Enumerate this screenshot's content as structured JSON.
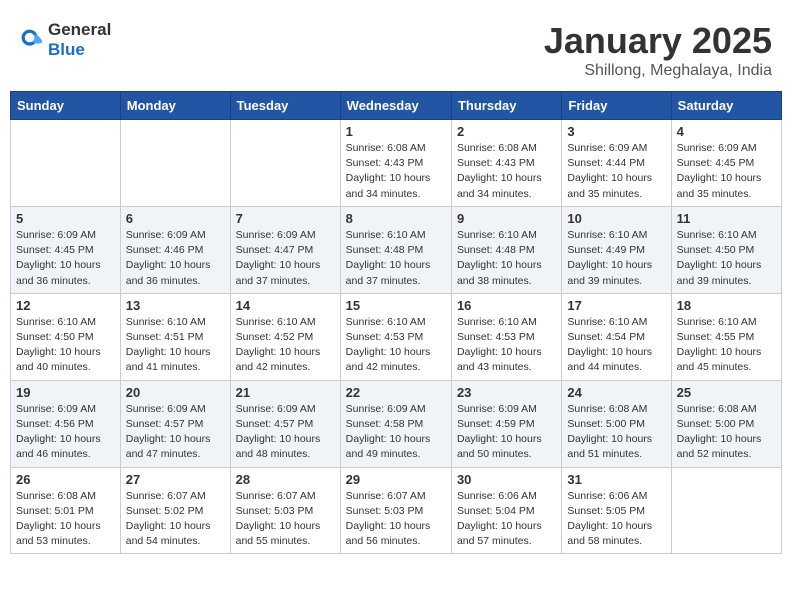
{
  "header": {
    "logo_general": "General",
    "logo_blue": "Blue",
    "title": "January 2025",
    "subtitle": "Shillong, Meghalaya, India"
  },
  "weekdays": [
    "Sunday",
    "Monday",
    "Tuesday",
    "Wednesday",
    "Thursday",
    "Friday",
    "Saturday"
  ],
  "weeks": [
    [
      {
        "day": "",
        "info": ""
      },
      {
        "day": "",
        "info": ""
      },
      {
        "day": "",
        "info": ""
      },
      {
        "day": "1",
        "info": "Sunrise: 6:08 AM\nSunset: 4:43 PM\nDaylight: 10 hours\nand 34 minutes."
      },
      {
        "day": "2",
        "info": "Sunrise: 6:08 AM\nSunset: 4:43 PM\nDaylight: 10 hours\nand 34 minutes."
      },
      {
        "day": "3",
        "info": "Sunrise: 6:09 AM\nSunset: 4:44 PM\nDaylight: 10 hours\nand 35 minutes."
      },
      {
        "day": "4",
        "info": "Sunrise: 6:09 AM\nSunset: 4:45 PM\nDaylight: 10 hours\nand 35 minutes."
      }
    ],
    [
      {
        "day": "5",
        "info": "Sunrise: 6:09 AM\nSunset: 4:45 PM\nDaylight: 10 hours\nand 36 minutes."
      },
      {
        "day": "6",
        "info": "Sunrise: 6:09 AM\nSunset: 4:46 PM\nDaylight: 10 hours\nand 36 minutes."
      },
      {
        "day": "7",
        "info": "Sunrise: 6:09 AM\nSunset: 4:47 PM\nDaylight: 10 hours\nand 37 minutes."
      },
      {
        "day": "8",
        "info": "Sunrise: 6:10 AM\nSunset: 4:48 PM\nDaylight: 10 hours\nand 37 minutes."
      },
      {
        "day": "9",
        "info": "Sunrise: 6:10 AM\nSunset: 4:48 PM\nDaylight: 10 hours\nand 38 minutes."
      },
      {
        "day": "10",
        "info": "Sunrise: 6:10 AM\nSunset: 4:49 PM\nDaylight: 10 hours\nand 39 minutes."
      },
      {
        "day": "11",
        "info": "Sunrise: 6:10 AM\nSunset: 4:50 PM\nDaylight: 10 hours\nand 39 minutes."
      }
    ],
    [
      {
        "day": "12",
        "info": "Sunrise: 6:10 AM\nSunset: 4:50 PM\nDaylight: 10 hours\nand 40 minutes."
      },
      {
        "day": "13",
        "info": "Sunrise: 6:10 AM\nSunset: 4:51 PM\nDaylight: 10 hours\nand 41 minutes."
      },
      {
        "day": "14",
        "info": "Sunrise: 6:10 AM\nSunset: 4:52 PM\nDaylight: 10 hours\nand 42 minutes."
      },
      {
        "day": "15",
        "info": "Sunrise: 6:10 AM\nSunset: 4:53 PM\nDaylight: 10 hours\nand 42 minutes."
      },
      {
        "day": "16",
        "info": "Sunrise: 6:10 AM\nSunset: 4:53 PM\nDaylight: 10 hours\nand 43 minutes."
      },
      {
        "day": "17",
        "info": "Sunrise: 6:10 AM\nSunset: 4:54 PM\nDaylight: 10 hours\nand 44 minutes."
      },
      {
        "day": "18",
        "info": "Sunrise: 6:10 AM\nSunset: 4:55 PM\nDaylight: 10 hours\nand 45 minutes."
      }
    ],
    [
      {
        "day": "19",
        "info": "Sunrise: 6:09 AM\nSunset: 4:56 PM\nDaylight: 10 hours\nand 46 minutes."
      },
      {
        "day": "20",
        "info": "Sunrise: 6:09 AM\nSunset: 4:57 PM\nDaylight: 10 hours\nand 47 minutes."
      },
      {
        "day": "21",
        "info": "Sunrise: 6:09 AM\nSunset: 4:57 PM\nDaylight: 10 hours\nand 48 minutes."
      },
      {
        "day": "22",
        "info": "Sunrise: 6:09 AM\nSunset: 4:58 PM\nDaylight: 10 hours\nand 49 minutes."
      },
      {
        "day": "23",
        "info": "Sunrise: 6:09 AM\nSunset: 4:59 PM\nDaylight: 10 hours\nand 50 minutes."
      },
      {
        "day": "24",
        "info": "Sunrise: 6:08 AM\nSunset: 5:00 PM\nDaylight: 10 hours\nand 51 minutes."
      },
      {
        "day": "25",
        "info": "Sunrise: 6:08 AM\nSunset: 5:00 PM\nDaylight: 10 hours\nand 52 minutes."
      }
    ],
    [
      {
        "day": "26",
        "info": "Sunrise: 6:08 AM\nSunset: 5:01 PM\nDaylight: 10 hours\nand 53 minutes."
      },
      {
        "day": "27",
        "info": "Sunrise: 6:07 AM\nSunset: 5:02 PM\nDaylight: 10 hours\nand 54 minutes."
      },
      {
        "day": "28",
        "info": "Sunrise: 6:07 AM\nSunset: 5:03 PM\nDaylight: 10 hours\nand 55 minutes."
      },
      {
        "day": "29",
        "info": "Sunrise: 6:07 AM\nSunset: 5:03 PM\nDaylight: 10 hours\nand 56 minutes."
      },
      {
        "day": "30",
        "info": "Sunrise: 6:06 AM\nSunset: 5:04 PM\nDaylight: 10 hours\nand 57 minutes."
      },
      {
        "day": "31",
        "info": "Sunrise: 6:06 AM\nSunset: 5:05 PM\nDaylight: 10 hours\nand 58 minutes."
      },
      {
        "day": "",
        "info": ""
      }
    ]
  ]
}
